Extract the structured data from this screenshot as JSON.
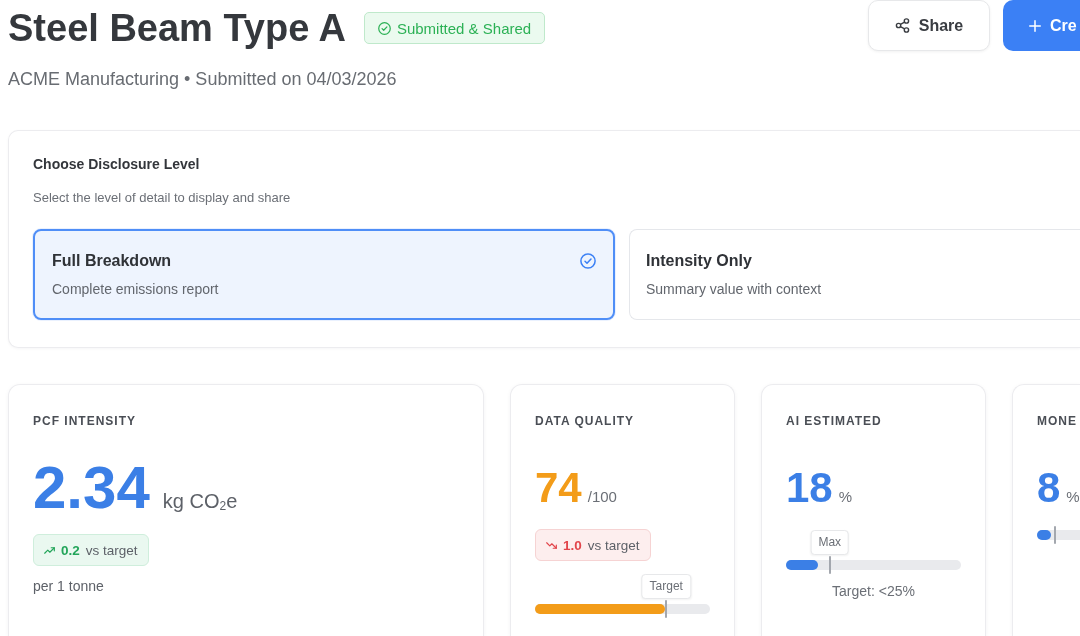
{
  "header": {
    "title": "Steel Beam Type A",
    "status": "Submitted & Shared",
    "subtitle": "ACME Manufacturing • Submitted on 04/03/2026",
    "buttons": [
      {
        "kind": "share",
        "label": "Share"
      },
      {
        "kind": "create",
        "label": "Cre"
      }
    ]
  },
  "disclosure": {
    "title": "Choose Disclosure Level",
    "description": "Select the level of detail to display and share",
    "options": [
      {
        "title": "Full Breakdown",
        "description": "Complete emissions report",
        "selected": true
      },
      {
        "title": "Intensity Only",
        "description": "Summary value with context",
        "selected": false
      }
    ]
  },
  "metrics": [
    {
      "kind": "headline",
      "label": "PCF INTENSITY",
      "value": "2.34",
      "unit": "kg CO$_{2}$e",
      "color": "#3b7fe6",
      "delta": {
        "kind": "up",
        "value": "0.2",
        "text": "vs target"
      },
      "note": "per 1 tonne"
    },
    {
      "kind": "gauge",
      "label": "DATA QUALITY",
      "value": "74",
      "unit": "/100",
      "color": "#f39c19",
      "delta": {
        "kind": "down",
        "value": "1.0",
        "text": "vs target"
      },
      "progress": {
        "level": 0.74,
        "marker": {
          "level": 0.75,
          "label": "Target"
        }
      }
    },
    {
      "kind": "gauge",
      "label": "AI ESTIMATED",
      "value": "18",
      "unit": "%",
      "color": "#3b7fe6",
      "progress": {
        "level": 0.18,
        "marker": {
          "level": 0.25,
          "label": "Max"
        },
        "caption": "Target: <25%"
      }
    },
    {
      "kind": "gauge",
      "label": "MONE",
      "value": "8",
      "unit": "%",
      "color": "#3b7fe6",
      "progress": {
        "level": 0.08,
        "marker": {
          "level": 0.1
        }
      }
    }
  ]
}
